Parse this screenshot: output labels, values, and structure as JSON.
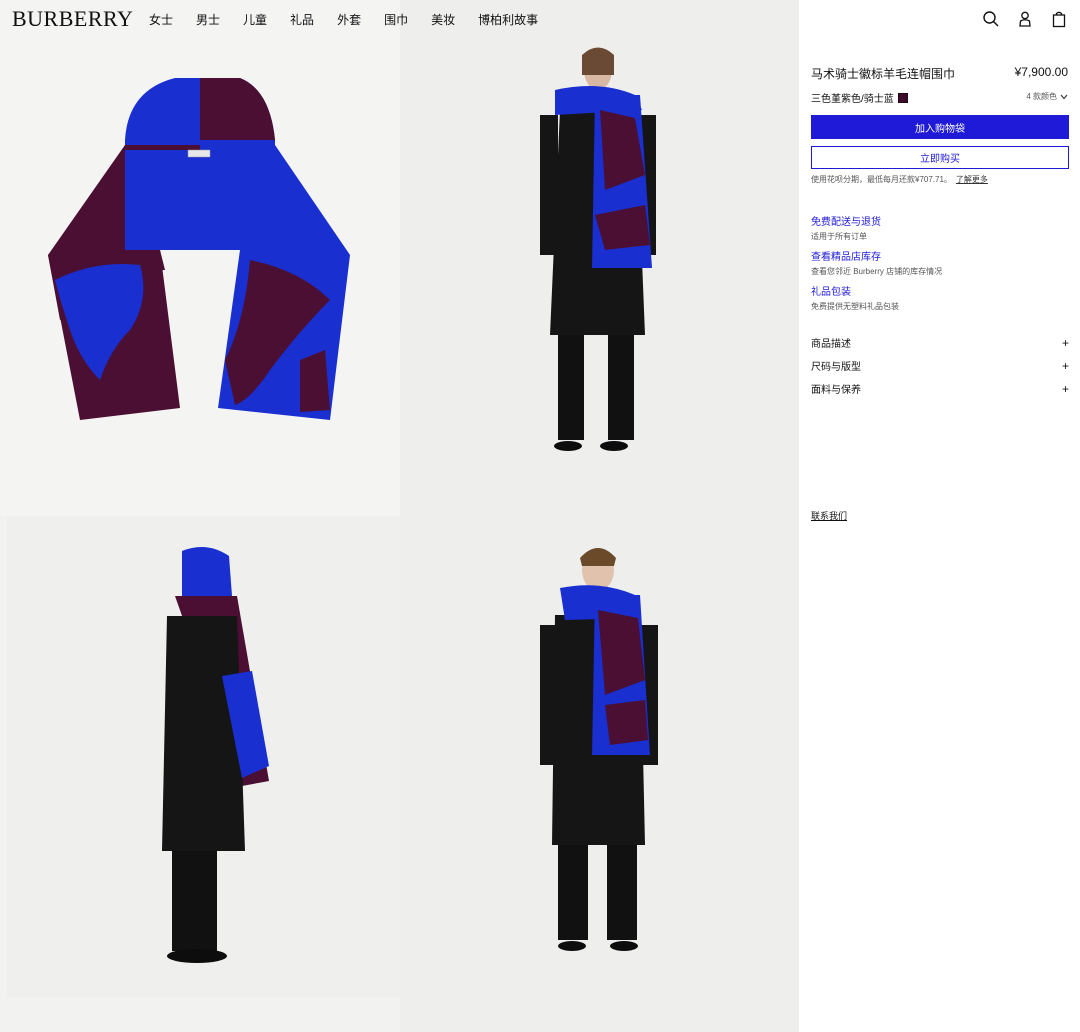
{
  "brand": {
    "logo": "BURBERRY"
  },
  "nav": {
    "items": [
      "女士",
      "男士",
      "儿童",
      "礼品",
      "外套",
      "围巾",
      "美妆",
      "博柏利故事"
    ]
  },
  "header_icons": [
    "search-icon",
    "account-icon",
    "shopping-bag-icon"
  ],
  "product": {
    "title": "马术骑士徽标羊毛连帽围巾",
    "price": "¥7,900.00",
    "color_label": "三色堇紫色/骑士蓝",
    "swatch_color": "#3d0b2c",
    "colors_count": "4 款颜色",
    "add_to_bag": "加入购物袋",
    "buy_now": "立即购买",
    "installment_text": "使用花呗分期，最低每月还款¥707.71。",
    "learn_more": "了解更多"
  },
  "services": [
    {
      "title": "免费配送与退货",
      "desc": "适用于所有订单"
    },
    {
      "title": "查看精品店库存",
      "desc": "查看您邻近 Burberry 店铺的库存情况"
    },
    {
      "title": "礼品包装",
      "desc": "免费提供无塑料礼品包装"
    }
  ],
  "accordion": [
    {
      "label": "商品描述",
      "icon": "+"
    },
    {
      "label": "尺码与版型",
      "icon": "+"
    },
    {
      "label": "面料与保养",
      "icon": "+"
    }
  ],
  "contact": "联系我们",
  "colors": {
    "accent_blue": "#1f1ad8",
    "scarf_blue": "#1a2fd0",
    "scarf_purple": "#4a0f33"
  }
}
